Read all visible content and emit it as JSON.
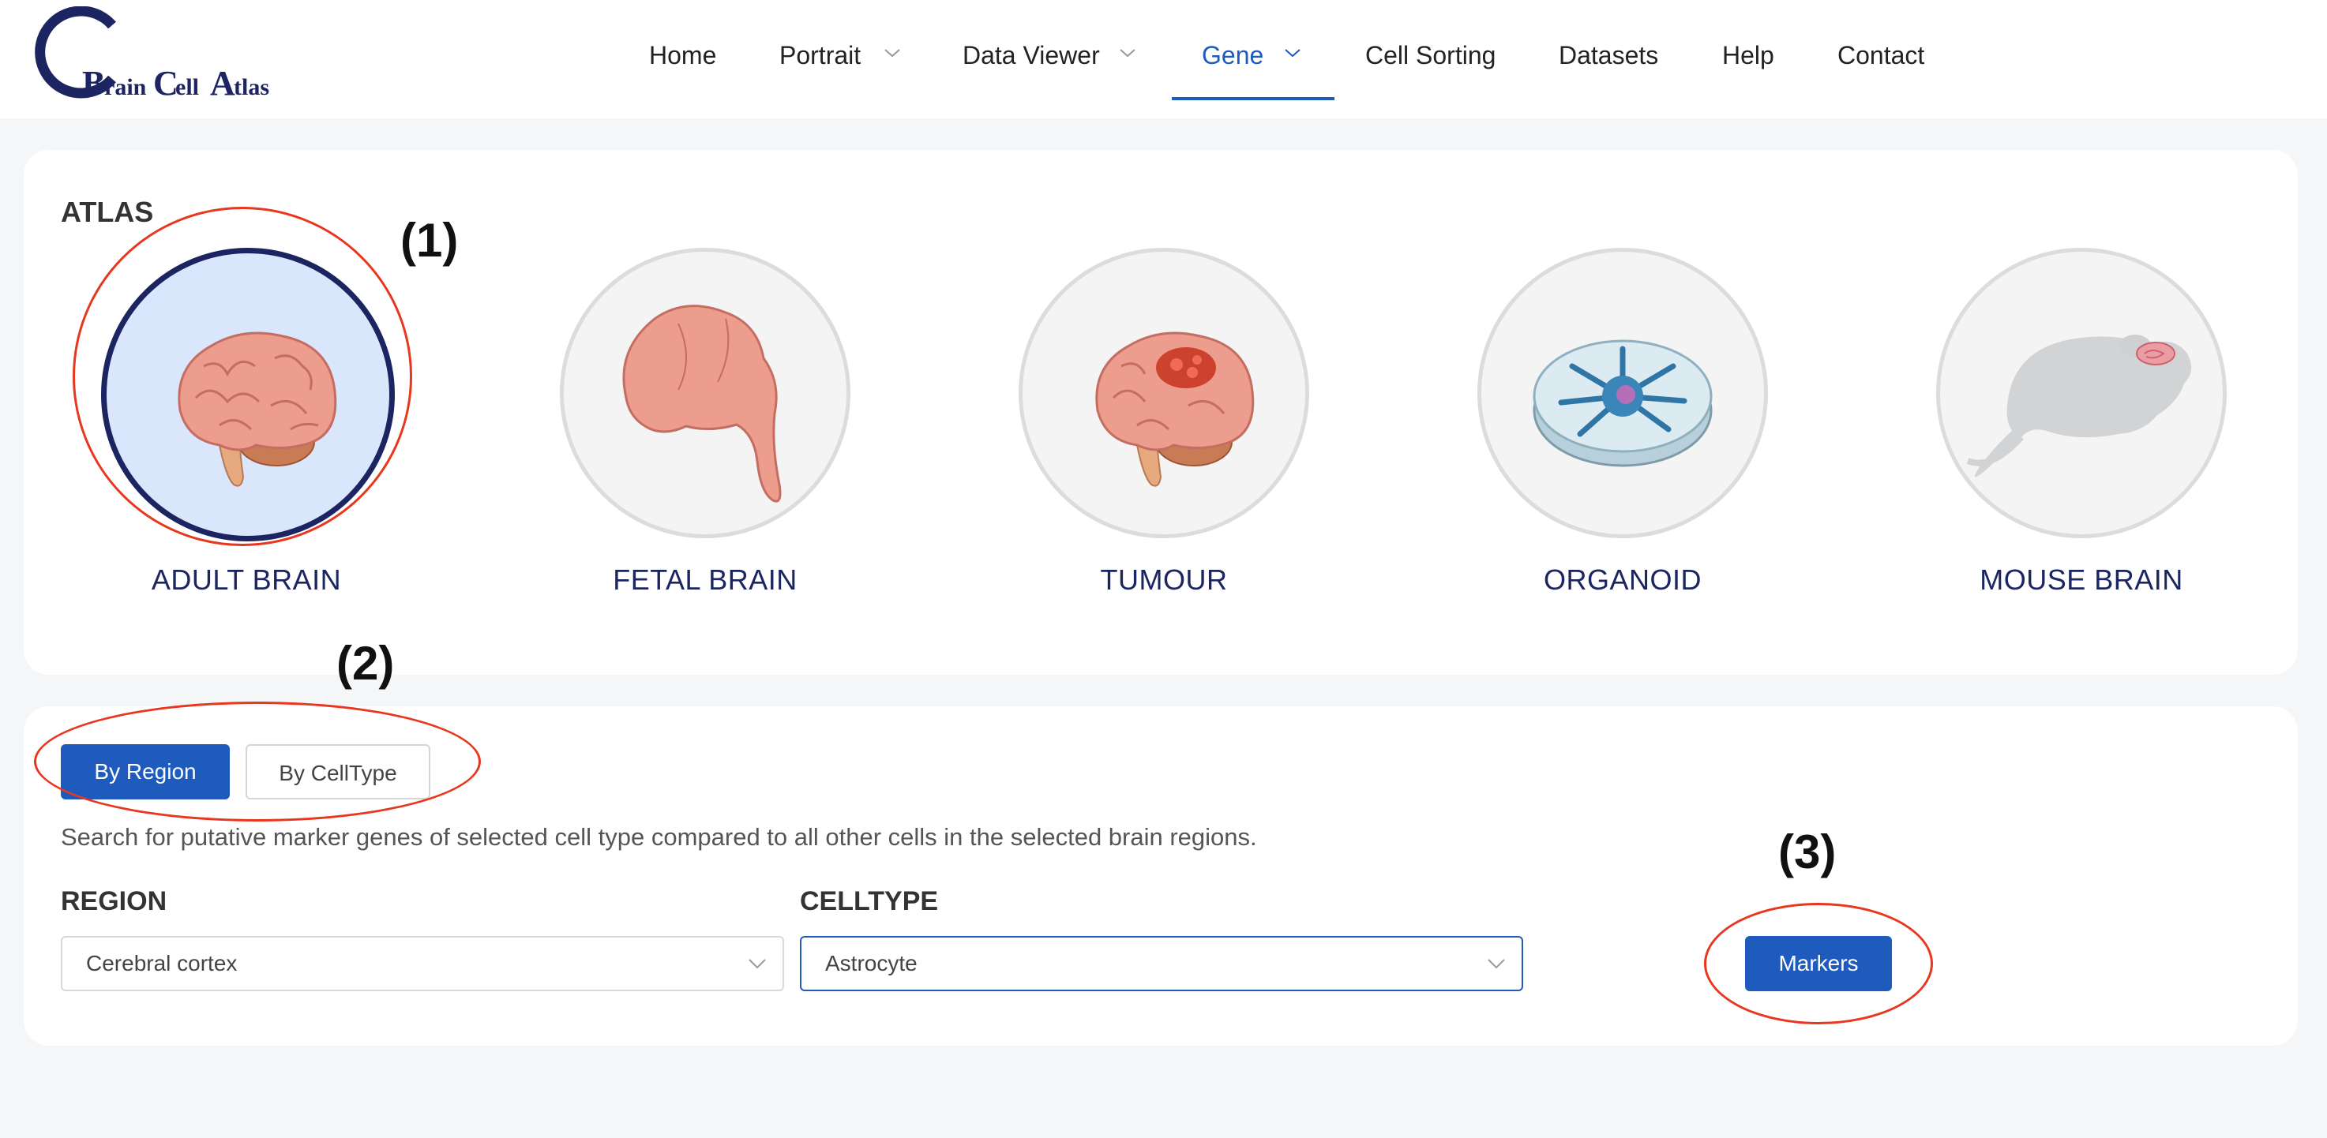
{
  "logo": {
    "text": "BrainCellAtlas"
  },
  "nav": {
    "items": [
      {
        "label": "Home",
        "has_dropdown": false
      },
      {
        "label": "Portrait",
        "has_dropdown": true
      },
      {
        "label": "Data Viewer",
        "has_dropdown": true
      },
      {
        "label": "Gene",
        "has_dropdown": true,
        "active": true
      },
      {
        "label": "Cell Sorting",
        "has_dropdown": false
      },
      {
        "label": "Datasets",
        "has_dropdown": false
      },
      {
        "label": "Help",
        "has_dropdown": false
      },
      {
        "label": "Contact",
        "has_dropdown": false
      }
    ]
  },
  "atlas": {
    "title": "ATLAS",
    "items": [
      {
        "label": "ADULT BRAIN",
        "icon": "adult-brain-icon",
        "selected": true
      },
      {
        "label": "FETAL BRAIN",
        "icon": "fetal-brain-icon",
        "selected": false
      },
      {
        "label": "TUMOUR",
        "icon": "tumour-brain-icon",
        "selected": false
      },
      {
        "label": "ORGANOID",
        "icon": "organoid-dish-icon",
        "selected": false
      },
      {
        "label": "MOUSE BRAIN",
        "icon": "mouse-icon",
        "selected": false
      }
    ]
  },
  "annotations": {
    "a1": "(1)",
    "a2": "(2)",
    "a3": "(3)"
  },
  "search": {
    "tabs": [
      {
        "label": "By Region",
        "active": true
      },
      {
        "label": "By CellType",
        "active": false
      }
    ],
    "description": "Search for putative marker genes of selected cell type compared to all other cells in the selected brain regions.",
    "region": {
      "label": "REGION",
      "value": "Cerebral cortex"
    },
    "celltype": {
      "label": "CELLTYPE",
      "value": "Astrocyte"
    },
    "markers_button": "Markers"
  },
  "colors": {
    "accent": "#1f5bbd",
    "navy": "#1b2560",
    "annotation_ring": "#e8371f",
    "selected_circle_bg": "#d9e6fb"
  }
}
